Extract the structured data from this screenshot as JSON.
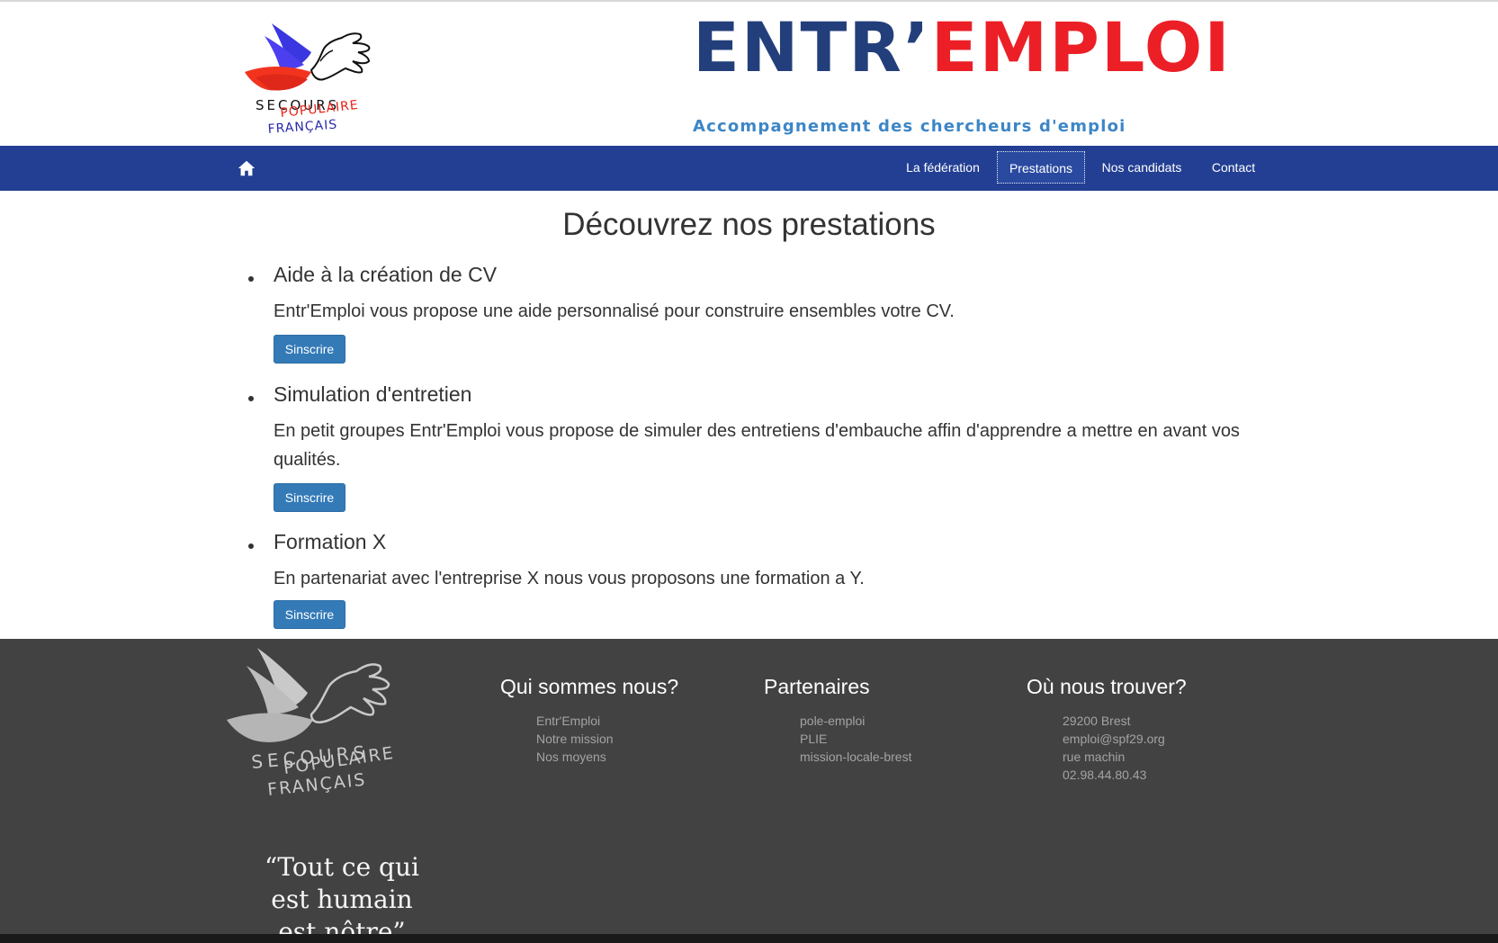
{
  "colors": {
    "navbar": "#233f93",
    "brand_blue": "#233f7b",
    "brand_red": "#ec1f26",
    "tagline": "#3d86c6",
    "button": "#337ab7",
    "footer": "#424242"
  },
  "header": {
    "logo_text": [
      "SECOURS",
      "POPULAIRE",
      "FRANÇAIS"
    ],
    "brand_part1": "ENTR’",
    "brand_part2": "EMPLOI",
    "tagline": "Accompagnement des chercheurs d'emploi"
  },
  "navbar": {
    "home_icon": "home-icon",
    "items": [
      {
        "label": "La fédération",
        "active": false
      },
      {
        "label": "Prestations",
        "active": true
      },
      {
        "label": "Nos candidats",
        "active": false
      },
      {
        "label": "Contact",
        "active": false
      }
    ]
  },
  "main": {
    "title": "Découvrez nos prestations",
    "services": [
      {
        "title": "Aide à la création de CV",
        "description": "Entr'Emploi vous propose une aide personnalisé pour construire ensembles votre CV.",
        "button": "Sinscrire"
      },
      {
        "title": "Simulation d'entretien",
        "description": "En petit groupes Entr'Emploi vous propose de simuler des entretiens d'embauche affin d'apprendre a mettre en avant vos qualités.",
        "button": "Sinscrire"
      },
      {
        "title": "Formation X",
        "description": "En partenariat avec l'entreprise X nous vous proposons une formation a Y.",
        "button": "Sinscrire"
      }
    ]
  },
  "footer": {
    "logo_text": [
      "SECOURS",
      "POPULAIRE",
      "FRANÇAIS"
    ],
    "quote_lines": [
      "“Tout ce qui",
      "est humain",
      "est nôtre”"
    ],
    "columns": [
      {
        "title": "Qui sommes nous?",
        "items": [
          "Entr'Emploi",
          "Notre mission",
          "Nos moyens"
        ]
      },
      {
        "title": "Partenaires",
        "items": [
          "pole-emploi",
          "PLIE",
          "mission-locale-brest"
        ]
      },
      {
        "title": "Où nous trouver?",
        "items": [
          "29200 Brest",
          "emploi@spf29.org",
          "rue machin",
          "02.98.44.80.43"
        ]
      }
    ]
  }
}
